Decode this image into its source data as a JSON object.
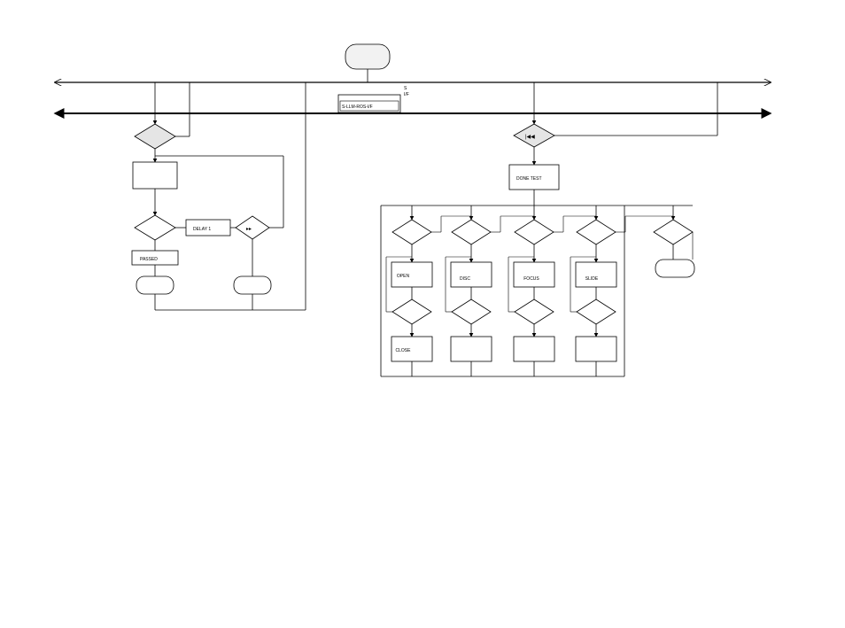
{
  "top": {
    "code_label": "S-LLM-ROS-I/F",
    "s_label": "S",
    "iff_label": "I/F"
  },
  "left": {
    "delay": "DELAY 1",
    "passed": "PASSED"
  },
  "right": {
    "switch_icon": "|◀◀",
    "done_test": "DONE TEST",
    "open": "OPEN",
    "disc": "DISC",
    "focus": "FOCUS",
    "slide": "SLIDE",
    "close": "CLOSE"
  }
}
